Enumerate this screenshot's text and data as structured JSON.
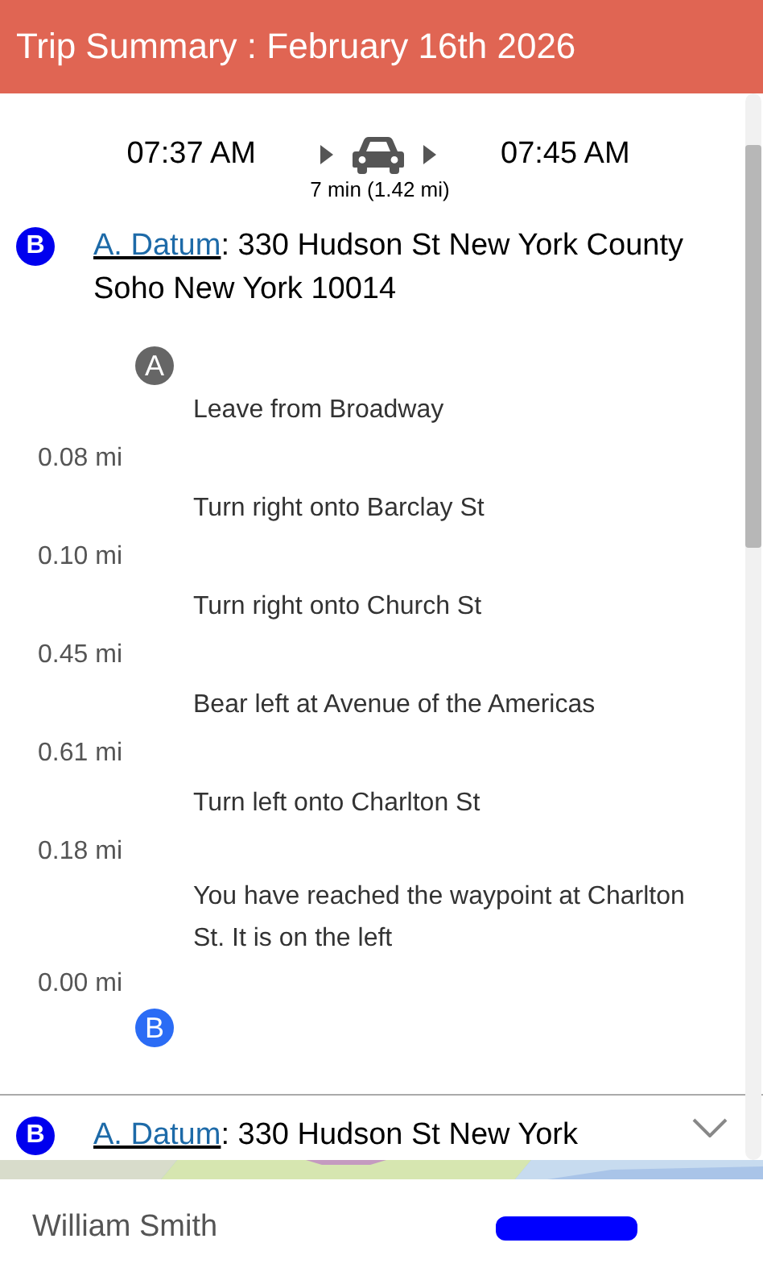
{
  "header": {
    "title": "Trip Summary : February 16th 2026"
  },
  "trip": {
    "depart": "07:37 AM",
    "arrive": "07:45 AM",
    "duration": "7 min (1.42 mi)"
  },
  "destination": {
    "marker": "B",
    "link": "A. Datum",
    "address": ": 330 Hudson St New York County Soho New York 10014"
  },
  "route": {
    "start_marker": "A",
    "end_marker": "B",
    "steps": [
      {
        "instruction": "Leave from Broadway",
        "distance": "0.08 mi"
      },
      {
        "instruction": "Turn right onto Barclay St",
        "distance": "0.10 mi"
      },
      {
        "instruction": "Turn right onto Church St",
        "distance": "0.45 mi"
      },
      {
        "instruction": "Bear left at Avenue of the Americas",
        "distance": "0.61 mi"
      },
      {
        "instruction": "Turn left onto Charlton St",
        "distance": "0.18 mi"
      },
      {
        "instruction": "You have reached the waypoint at Charlton St. It is on the left",
        "distance": "0.00 mi"
      }
    ]
  },
  "next_stop": {
    "marker": "B",
    "link": "A. Datum",
    "address": ": 330 Hudson St New York",
    "expanded": false
  },
  "footer": {
    "user": "William Smith"
  }
}
